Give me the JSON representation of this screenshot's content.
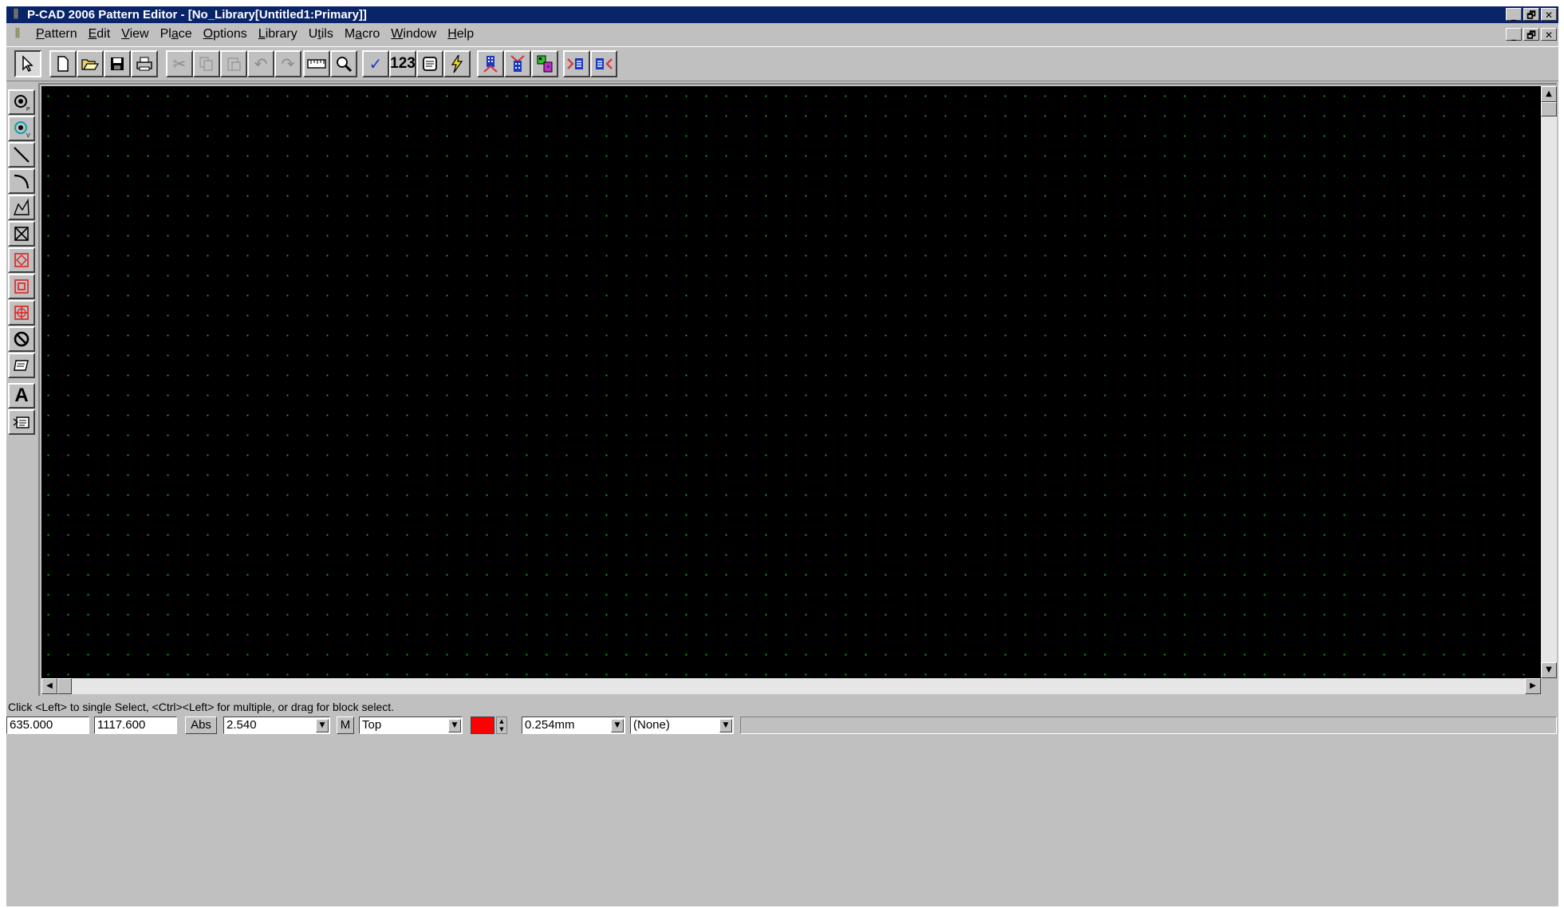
{
  "window": {
    "title": "P-CAD 2006 Pattern Editor - [No_Library[Untitled1:Primary]]",
    "app_icon": "pattern-editor-icon",
    "controls": [
      "_",
      "🗗",
      "✕"
    ]
  },
  "menubar": {
    "items": [
      {
        "u": "P",
        "rest": "attern"
      },
      {
        "u": "E",
        "rest": "dit"
      },
      {
        "u": "V",
        "rest": "iew"
      },
      {
        "pre": "Pl",
        "u": "a",
        "rest": "ce"
      },
      {
        "u": "O",
        "rest": "ptions"
      },
      {
        "u": "L",
        "rest": "ibrary"
      },
      {
        "pre": "U",
        "u": "t",
        "rest": "ils"
      },
      {
        "pre": "M",
        "u": "a",
        "rest": "cro"
      },
      {
        "u": "W",
        "rest": "indow"
      },
      {
        "u": "H",
        "rest": "elp"
      }
    ]
  },
  "toolbar": {
    "buttons": [
      "select",
      "new",
      "open",
      "save",
      "print",
      "cut",
      "copy",
      "paste",
      "undo",
      "redo",
      "measure",
      "zoom",
      "validate",
      "renumber",
      "pattern-info",
      "pattern-wizard",
      "pad-stack",
      "via-style",
      "place-pads",
      "shrink",
      "expand"
    ],
    "renumber_label": "123"
  },
  "left_tools": [
    "place-pad",
    "place-via",
    "place-line",
    "place-arc",
    "place-polygon",
    "place-point",
    "place-copper-pour",
    "place-cutout",
    "place-keepout",
    "place-plane",
    "place-attribute",
    "place-text",
    "place-field"
  ],
  "status": {
    "message": "Click <Left> to single Select, <Ctrl><Left> for multiple, or drag for block select.",
    "x": "635.000",
    "y": "1117.600",
    "abs_label": "Abs",
    "grid": "2.540",
    "mode_label": "M",
    "layer": "Top",
    "layer_color": "#ff0000",
    "line_width": "0.254mm",
    "style": "(None)"
  },
  "colors": {
    "canvas_bg": "#000000",
    "grid_dot": "#1fa01f",
    "titlebar": "#0a246a",
    "chrome": "#c0c0c0"
  }
}
